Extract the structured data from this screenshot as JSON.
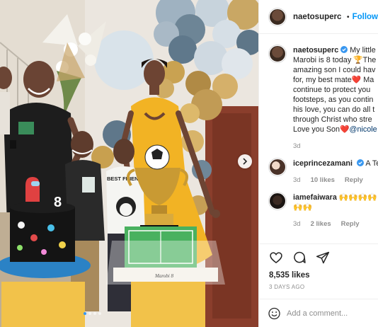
{
  "post": {
    "username": "naetosuperc",
    "follow_label": "Follow",
    "bullet": "•",
    "caption": {
      "username": "naetosuperc",
      "line1": "My little",
      "line2": "Marobi is 8 today 🏆The",
      "line3": "amazing son I could hav",
      "line4": "for, my best mate❤️ Ma",
      "line5": "continue to protect you",
      "line6": "footsteps, as you contin",
      "line7": "his love, you can do all t",
      "line8": "through Christ who stre",
      "line9_text": "Love you Son❤️",
      "line9_mention": "@nicole",
      "time": "3d"
    },
    "comments": [
      {
        "username": "iceprincezamani",
        "text": "A Te",
        "time": "3d",
        "likes": "10 likes",
        "reply": "Reply"
      },
      {
        "username": "iamefaiwara",
        "text": "🙌🙌🙌🙌",
        "text2": "🙌🙌",
        "time": "3d",
        "likes": "2 likes",
        "reply": "Reply"
      }
    ],
    "likes_count": "8,535 likes",
    "date": "3 DAYS AGO",
    "add_comment_placeholder": "Add a comment..."
  },
  "photo": {
    "cake_number": "8",
    "shirt_text": "BEST FRIEND",
    "board_text": "Marobi 8"
  },
  "icons": {
    "verified": "verified-badge-icon",
    "like": "heart-icon",
    "comment": "comment-icon",
    "share": "share-icon",
    "emoji": "emoji-icon",
    "next": "chevron-right-icon"
  },
  "colors": {
    "accent": "#0095f6",
    "verified": "#3897f0",
    "text": "#262626",
    "muted": "#8e8e8e",
    "dress": "#f2b324"
  }
}
